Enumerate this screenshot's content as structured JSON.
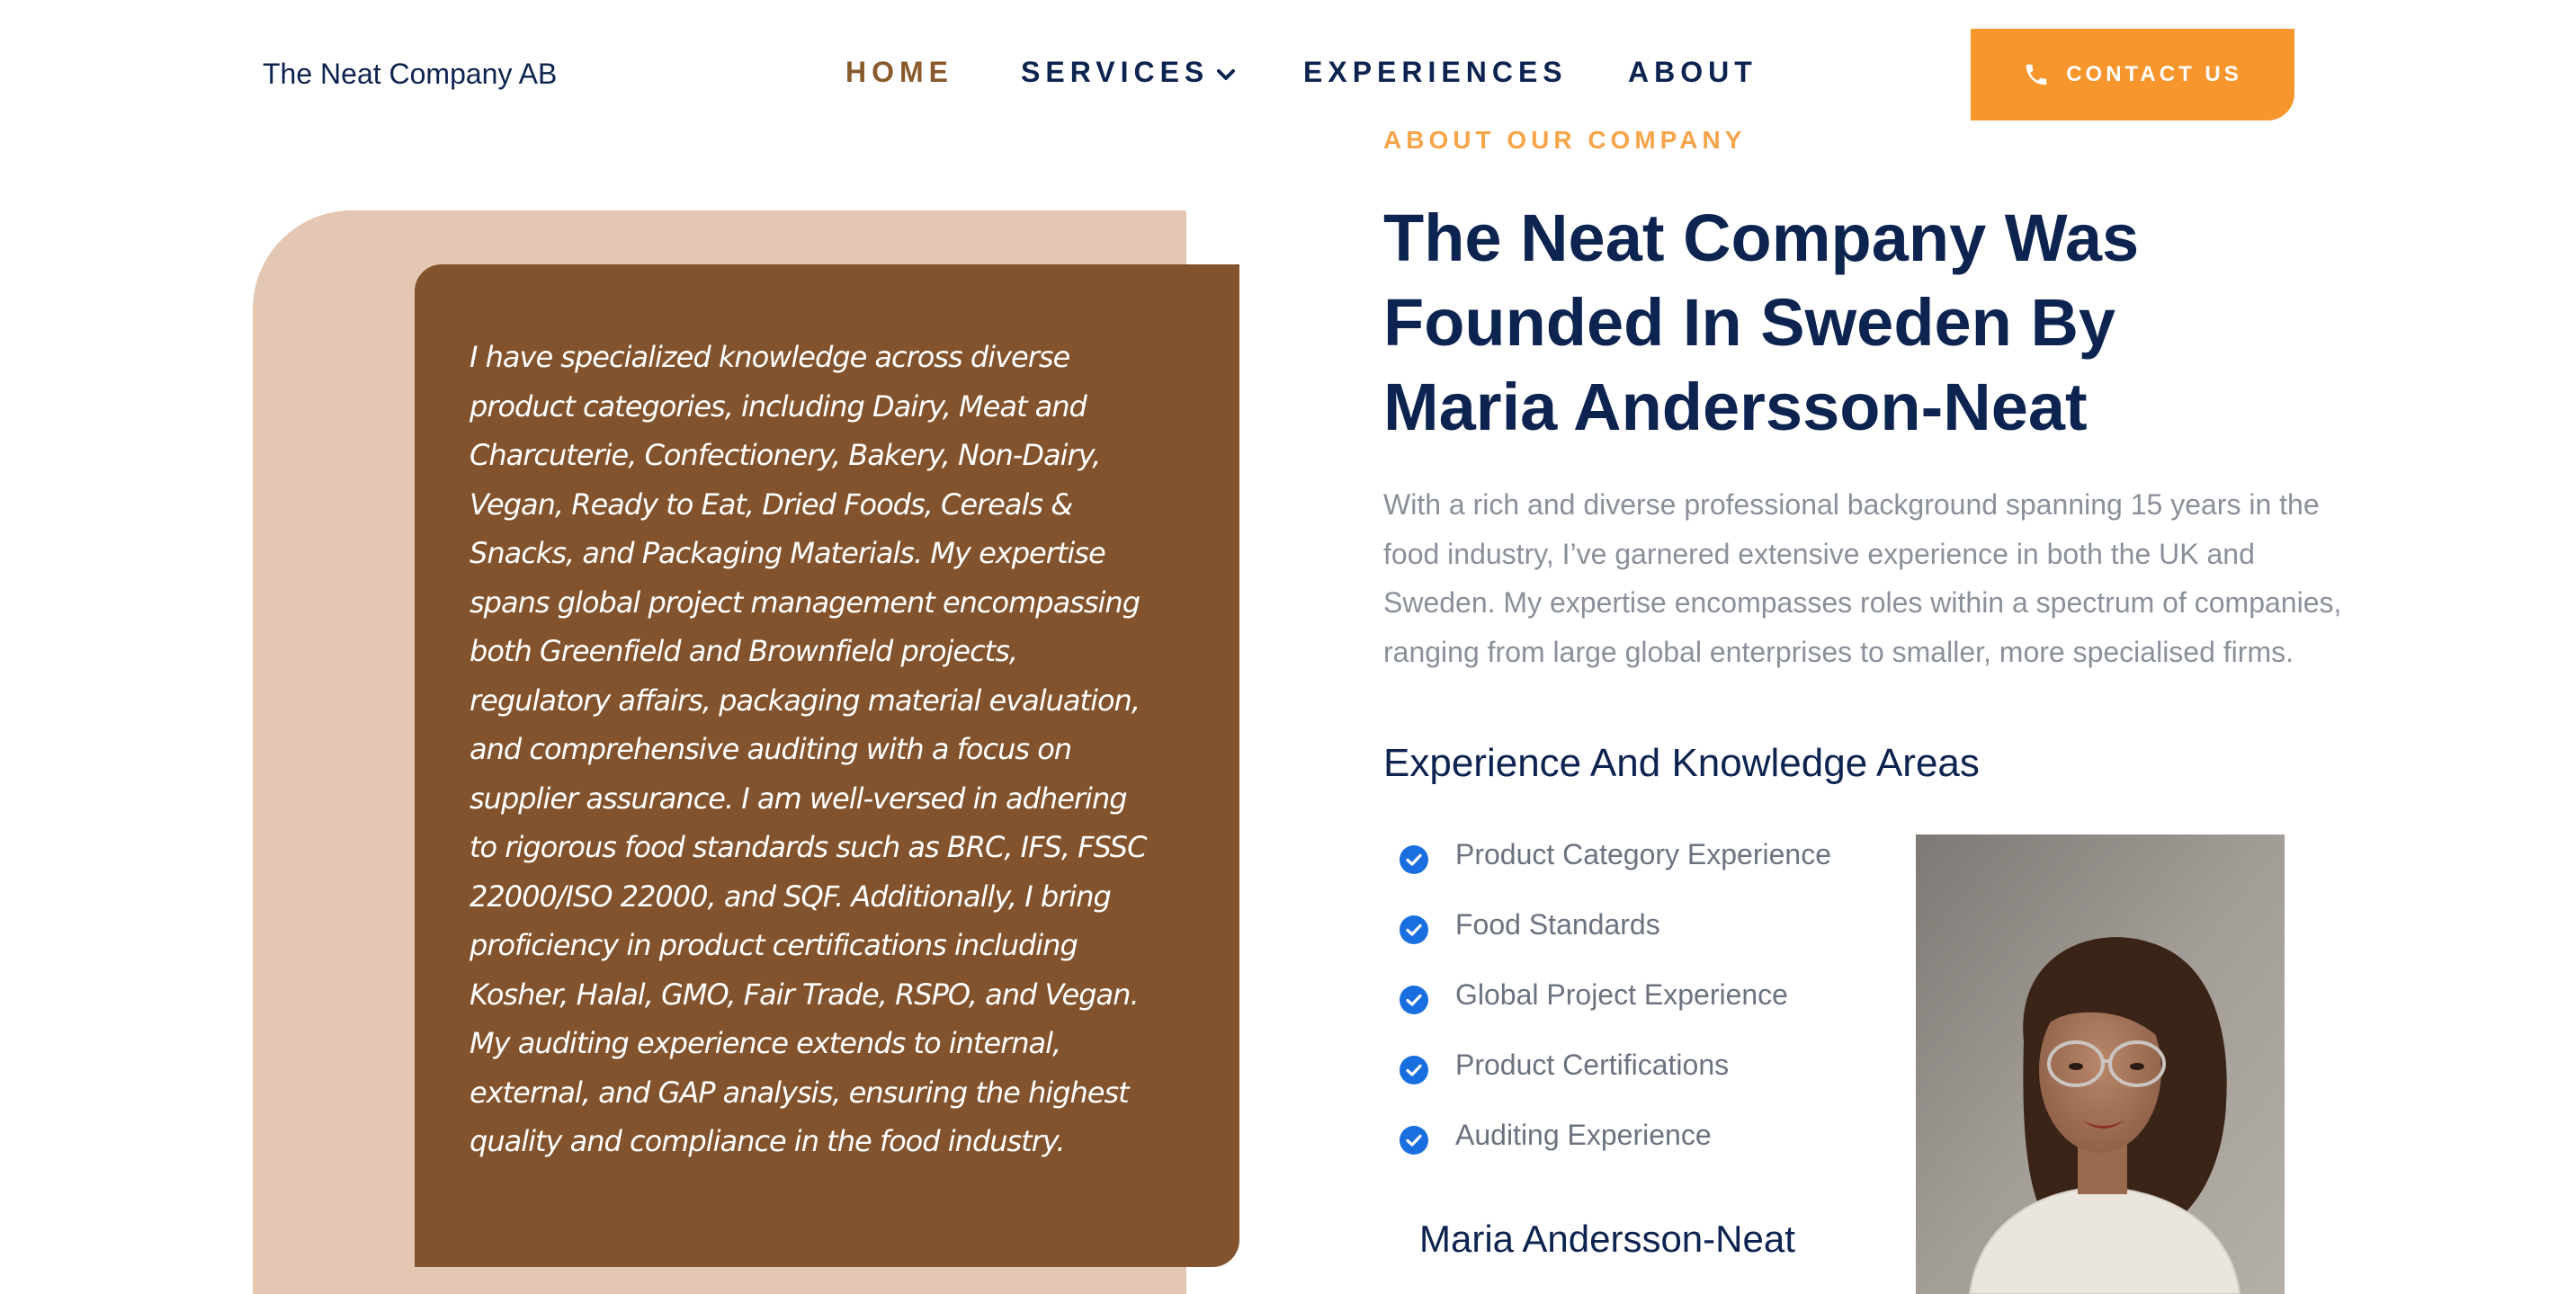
{
  "header": {
    "logo": "The Neat Company AB",
    "nav": [
      {
        "label": "HOME",
        "active": true
      },
      {
        "label": "SERVICES",
        "active": false
      },
      {
        "label": "EXPERIENCES",
        "active": false
      },
      {
        "label": "ABOUT",
        "active": false
      }
    ],
    "contact_label": "CONTACT US"
  },
  "left_panel": {
    "quote": "I have specialized knowledge across diverse product categories, including Dairy, Meat and Charcuterie, Confectionery, Bakery, Non-Dairy, Vegan, Ready to Eat, Dried Foods, Cereals & Snacks, and Packaging Materials. My expertise spans global project management encompassing both Greenfield and Brownfield projects, regulatory affairs, packaging material evaluation, and comprehensive auditing with a focus on supplier assurance. I am well-versed in adhering to rigorous food standards such as BRC, IFS, FSSC 22000/ISO 22000, and SQF. Additionally, I bring proficiency in product certifications including Kosher, Halal, GMO, Fair Trade, RSPO, and Vegan. My auditing experience extends to internal, external, and GAP analysis, ensuring the highest quality and compliance in the food industry."
  },
  "about": {
    "eyebrow": "ABOUT OUR COMPANY",
    "heading": "The Neat Company Was Founded In Sweden By Maria Andersson-Neat",
    "intro": "With a rich and diverse professional background spanning 15 years in the food industry, I’ve garnered extensive experience in both the UK and Sweden. My expertise encompasses roles within a spectrum of companies, ranging from large global enterprises to smaller, more specialised firms.",
    "subheading": "Experience And Knowledge Areas",
    "list": [
      "Product Category Experience",
      "Food Standards",
      "Global Project Experience",
      "Product Certifications",
      "Auditing Experience"
    ],
    "person_name": "Maria Andersson-Neat"
  },
  "colors": {
    "navy": "#0d2350",
    "orange": "#f7962d",
    "brown": "#82532c",
    "beige": "#e4c7b2",
    "check_blue": "#1a6fe0"
  },
  "icons": {
    "services_dropdown": "chevron-down-icon",
    "contact": "phone-icon",
    "list_item": "check-circle-icon"
  }
}
